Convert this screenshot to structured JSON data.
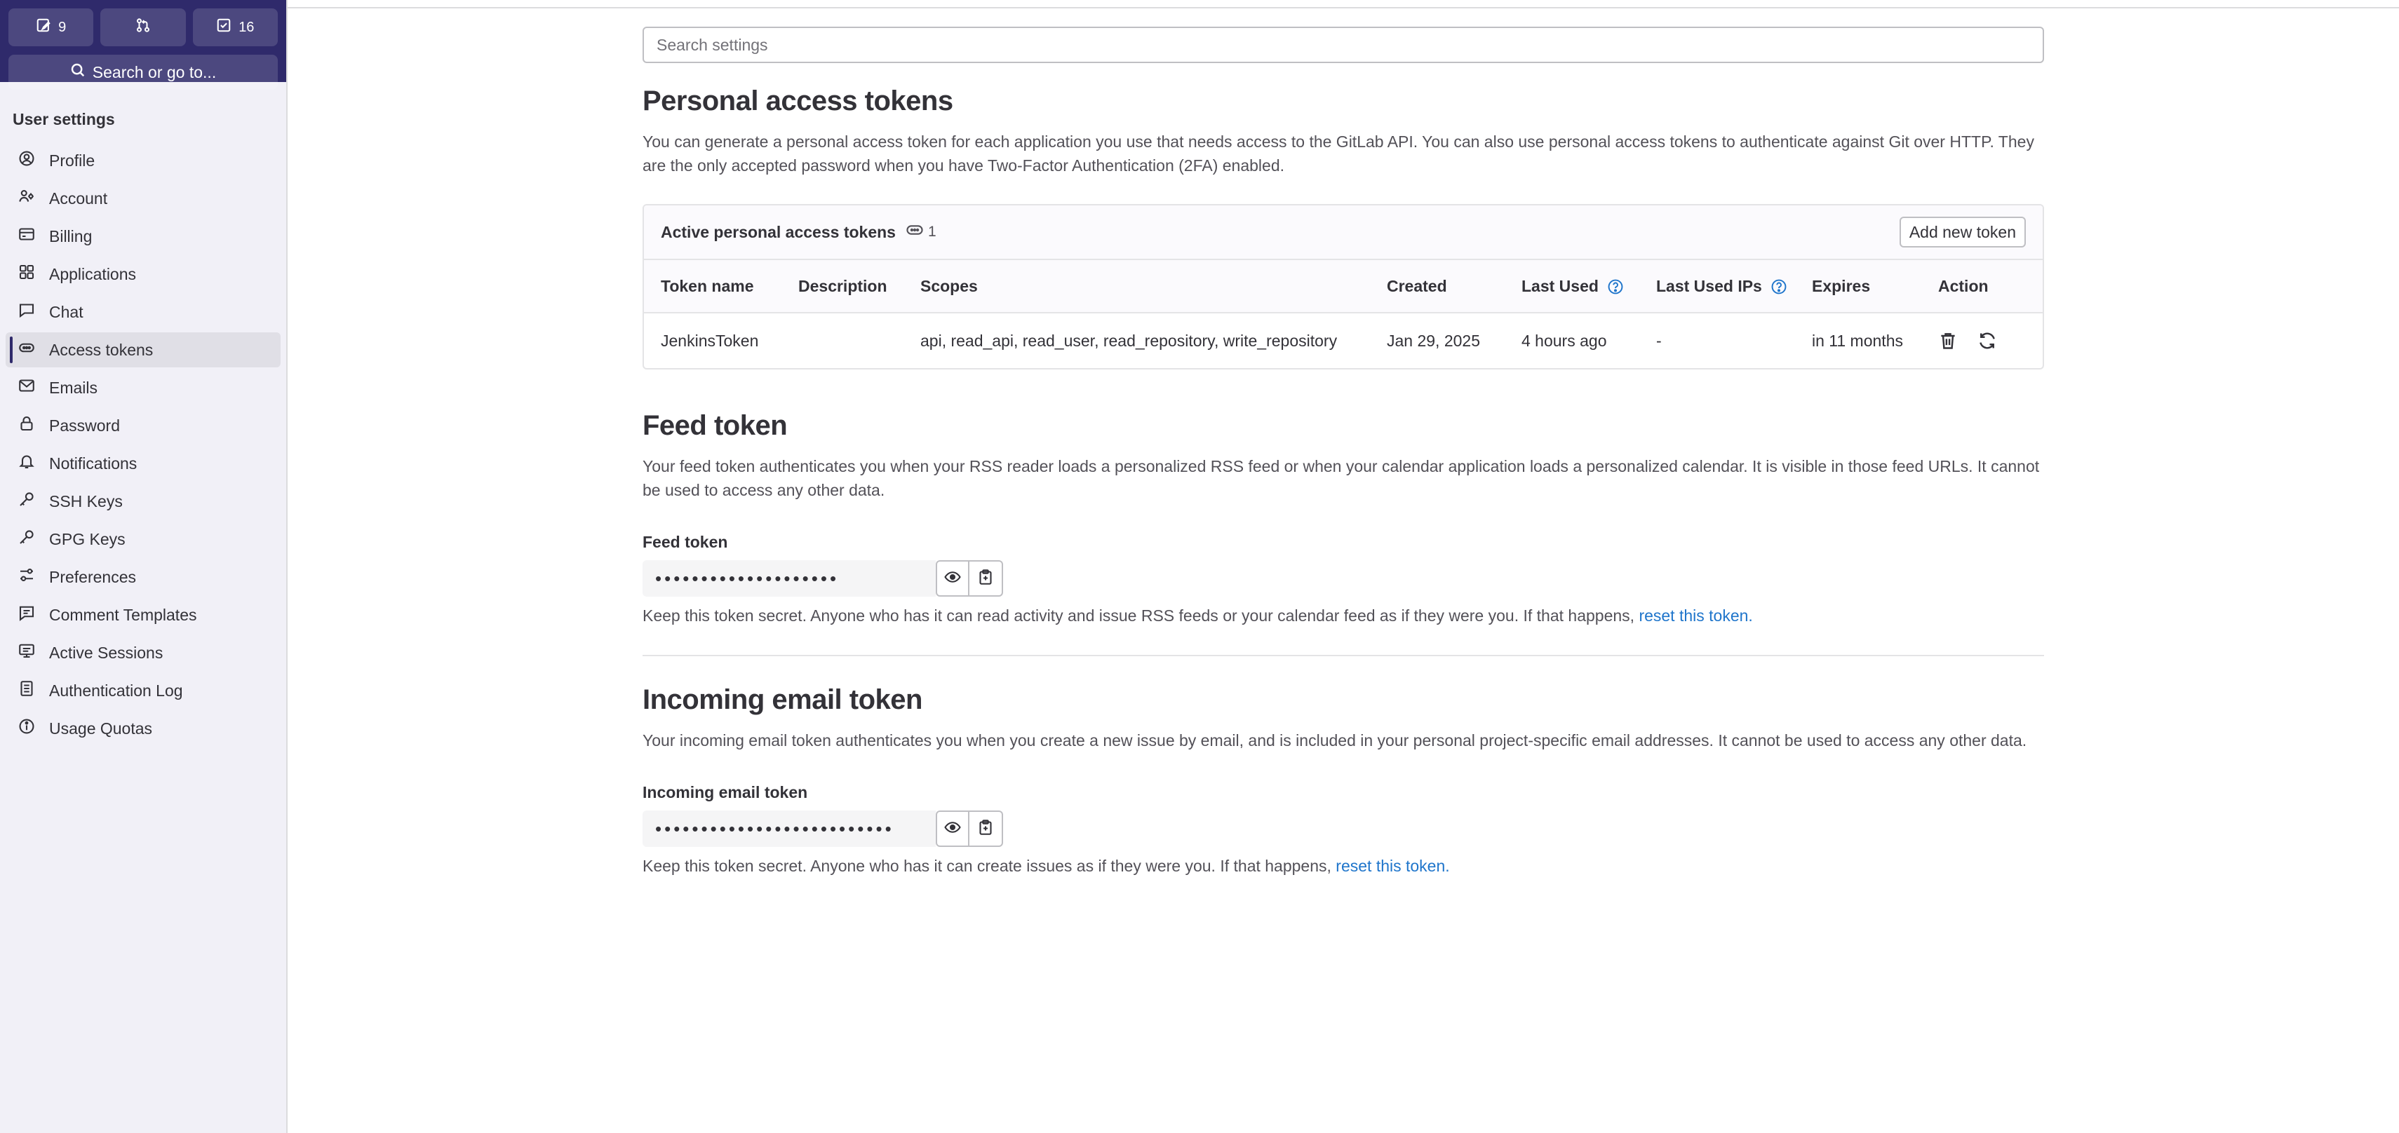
{
  "sidebar": {
    "counters": [
      {
        "icon": "issues-icon",
        "count": "9"
      },
      {
        "icon": "merge-request-icon",
        "count": ""
      },
      {
        "icon": "todo-icon",
        "count": "16"
      }
    ],
    "search_label": "Search or go to...",
    "heading": "User settings",
    "items": [
      {
        "label": "Profile",
        "icon": "profile-icon"
      },
      {
        "label": "Account",
        "icon": "account-icon"
      },
      {
        "label": "Billing",
        "icon": "billing-icon"
      },
      {
        "label": "Applications",
        "icon": "applications-icon"
      },
      {
        "label": "Chat",
        "icon": "chat-icon"
      },
      {
        "label": "Access tokens",
        "icon": "token-icon",
        "active": true
      },
      {
        "label": "Emails",
        "icon": "mail-icon"
      },
      {
        "label": "Password",
        "icon": "lock-icon"
      },
      {
        "label": "Notifications",
        "icon": "bell-icon"
      },
      {
        "label": "SSH Keys",
        "icon": "key-icon"
      },
      {
        "label": "GPG Keys",
        "icon": "key-icon"
      },
      {
        "label": "Preferences",
        "icon": "preferences-icon"
      },
      {
        "label": "Comment Templates",
        "icon": "comment-icon"
      },
      {
        "label": "Active Sessions",
        "icon": "monitor-icon"
      },
      {
        "label": "Authentication Log",
        "icon": "log-icon"
      },
      {
        "label": "Usage Quotas",
        "icon": "quota-icon"
      }
    ]
  },
  "search": {
    "placeholder": "Search settings"
  },
  "pat": {
    "title": "Personal access tokens",
    "description": "You can generate a personal access token for each application you use that needs access to the GitLab API. You can also use personal access tokens to authenticate against Git over HTTP. They are the only accepted password when you have Two-Factor Authentication (2FA) enabled.",
    "card_title": "Active personal access tokens",
    "count": "1",
    "add_button": "Add new token",
    "columns": [
      "Token name",
      "Description",
      "Scopes",
      "Created",
      "Last Used",
      "Last Used IPs",
      "Expires",
      "Action"
    ],
    "rows": [
      {
        "name": "JenkinsToken",
        "description": "",
        "scopes": "api, read_api, read_user, read_repository, write_repository",
        "created": "Jan 29, 2025",
        "last_used": "4 hours ago",
        "last_used_ips": "-",
        "expires": "in 11 months"
      }
    ]
  },
  "feed": {
    "title": "Feed token",
    "description": "Your feed token authenticates you when your RSS reader loads a personalized RSS feed or when your calendar application loads a personalized calendar. It is visible in those feed URLs. It cannot be used to access any other data.",
    "label": "Feed token",
    "masked": "••••••••••••••••••••",
    "helper": "Keep this token secret. Anyone who has it can read activity and issue RSS feeds or your calendar feed as if they were you. If that happens,",
    "link": "reset this token."
  },
  "incoming": {
    "title": "Incoming email token",
    "description": "Your incoming email token authenticates you when you create a new issue by email, and is included in your personal project-specific email addresses. It cannot be used to access any other data.",
    "label": "Incoming email token",
    "masked": "••••••••••••••••••••••••••",
    "helper": "Keep this token secret. Anyone who has it can create issues as if they were you. If that happens,",
    "link": "reset this token."
  }
}
